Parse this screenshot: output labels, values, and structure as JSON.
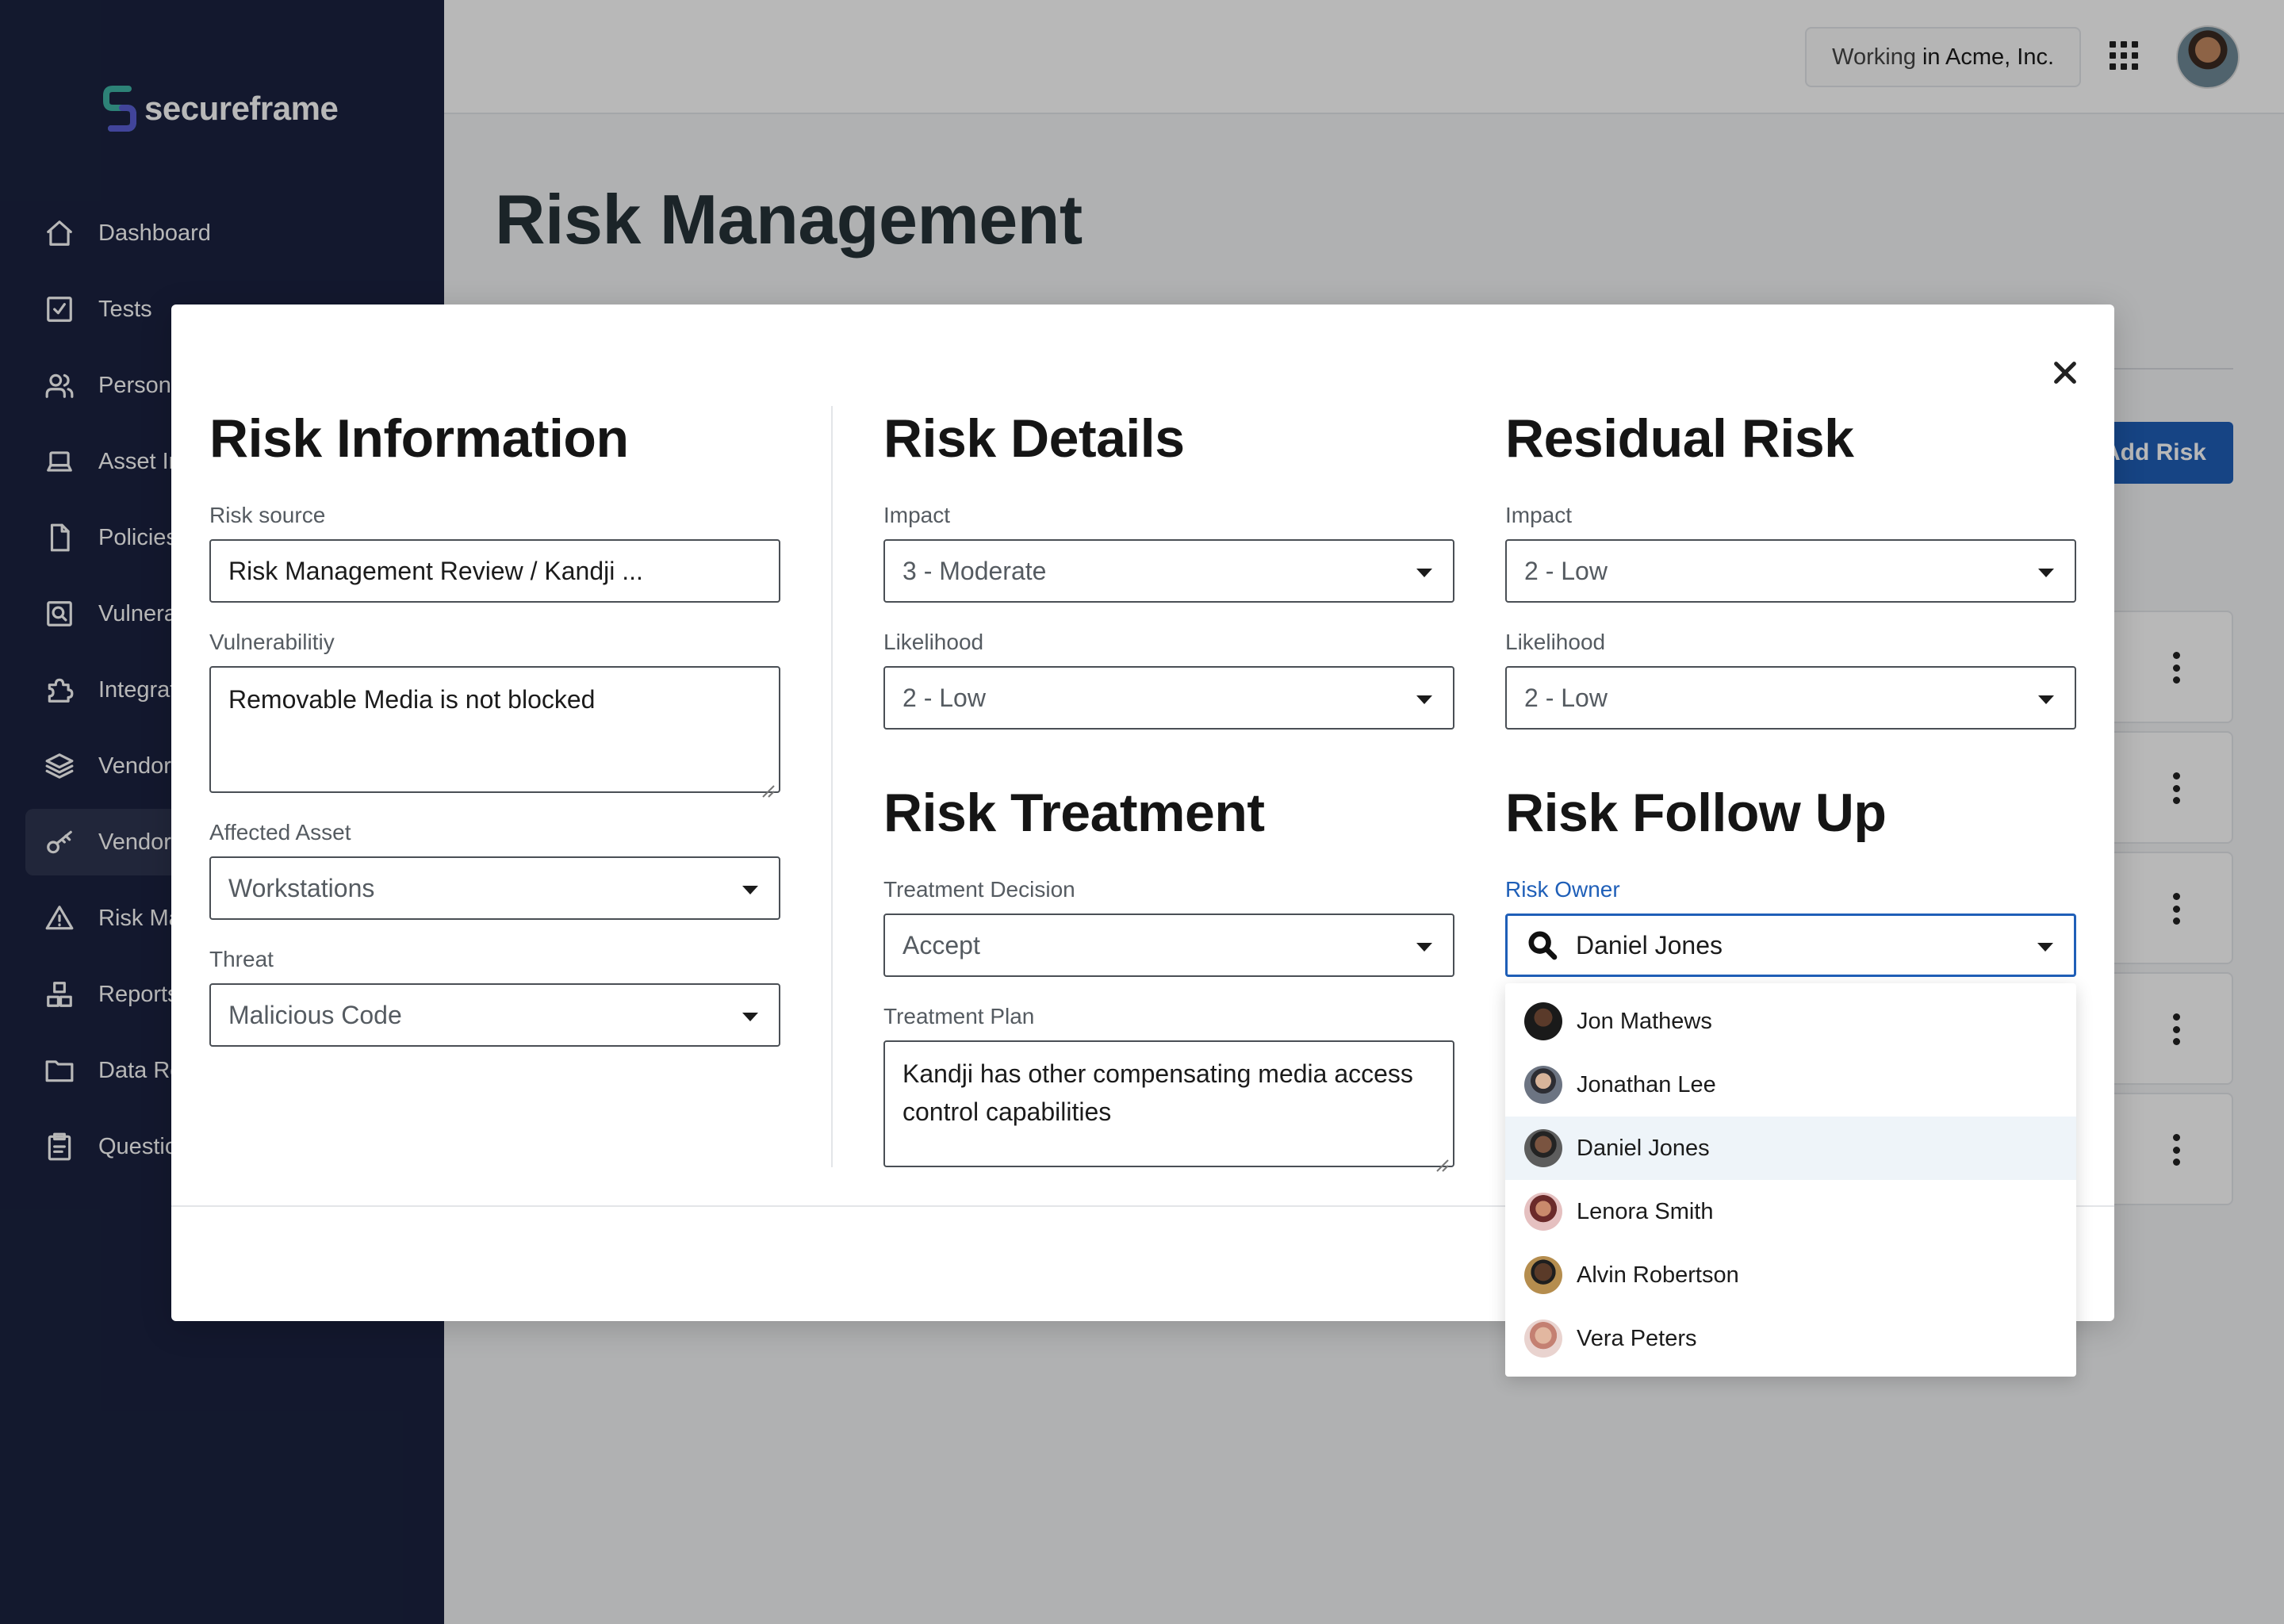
{
  "brand": {
    "name": "secureframe"
  },
  "sidebar": {
    "items": [
      {
        "label": "Dashboard",
        "icon": "home-icon"
      },
      {
        "label": "Tests",
        "icon": "checkbox-icon"
      },
      {
        "label": "Personnel",
        "icon": "users-icon"
      },
      {
        "label": "Asset Inventory",
        "icon": "laptop-icon"
      },
      {
        "label": "Policies",
        "icon": "file-icon"
      },
      {
        "label": "Vulnerabilities",
        "icon": "scan-icon"
      },
      {
        "label": "Integrations",
        "icon": "puzzle-icon"
      },
      {
        "label": "Vendors",
        "icon": "layers-icon"
      },
      {
        "label": "Vendor Access",
        "icon": "key-icon",
        "active": true
      },
      {
        "label": "Risk Management",
        "icon": "alert-triangle-icon"
      },
      {
        "label": "Reports",
        "icon": "blocks-icon"
      },
      {
        "label": "Data Room",
        "icon": "folder-icon"
      },
      {
        "label": "Questionnaires",
        "icon": "clipboard-icon"
      }
    ]
  },
  "topbar": {
    "working_prefix": "Working",
    "working_org": "in Acme, Inc."
  },
  "page": {
    "title": "Risk Management",
    "add_button": "Add Risk",
    "row_count": 5
  },
  "modal": {
    "risk_information": {
      "title": "Risk Information",
      "risk_source_label": "Risk source",
      "risk_source_value": "Risk Management Review / Kandji ...",
      "vulnerability_label": "Vulnerabilitiy",
      "vulnerability_value": "Removable Media is not blocked",
      "affected_asset_label": "Affected Asset",
      "affected_asset_value": "Workstations",
      "threat_label": "Threat",
      "threat_value": "Malicious Code"
    },
    "risk_details": {
      "title": "Risk Details",
      "impact_label": "Impact",
      "impact_value": "3 - Moderate",
      "likelihood_label": "Likelihood",
      "likelihood_value": "2 - Low"
    },
    "residual_risk": {
      "title": "Residual Risk",
      "impact_label": "Impact",
      "impact_value": "2 - Low",
      "likelihood_label": "Likelihood",
      "likelihood_value": "2 - Low"
    },
    "risk_treatment": {
      "title": "Risk Treatment",
      "decision_label": "Treatment Decision",
      "decision_value": "Accept",
      "plan_label": "Treatment Plan",
      "plan_value": "Kandji has other compensating media access control capabilities"
    },
    "risk_follow_up": {
      "title": "Risk Follow Up",
      "owner_label": "Risk Owner",
      "owner_value": "Daniel Jones",
      "owner_options": [
        {
          "name": "Jon Mathews",
          "avatar_color": "#2b2b2b"
        },
        {
          "name": "Jonathan Lee",
          "avatar_color": "#4a5160"
        },
        {
          "name": "Daniel Jones",
          "avatar_color": "#3a3a3a",
          "highlighted": true
        },
        {
          "name": "Lenora Smith",
          "avatar_color": "#c98a8a"
        },
        {
          "name": "Alvin Robertson",
          "avatar_color": "#8a6a3a"
        },
        {
          "name": "Vera Peters",
          "avatar_color": "#d0a6a0"
        }
      ]
    }
  },
  "colors": {
    "sidebar": "#1b2240",
    "accent": "#1f5fb8",
    "highlight": "#eef4f9"
  }
}
